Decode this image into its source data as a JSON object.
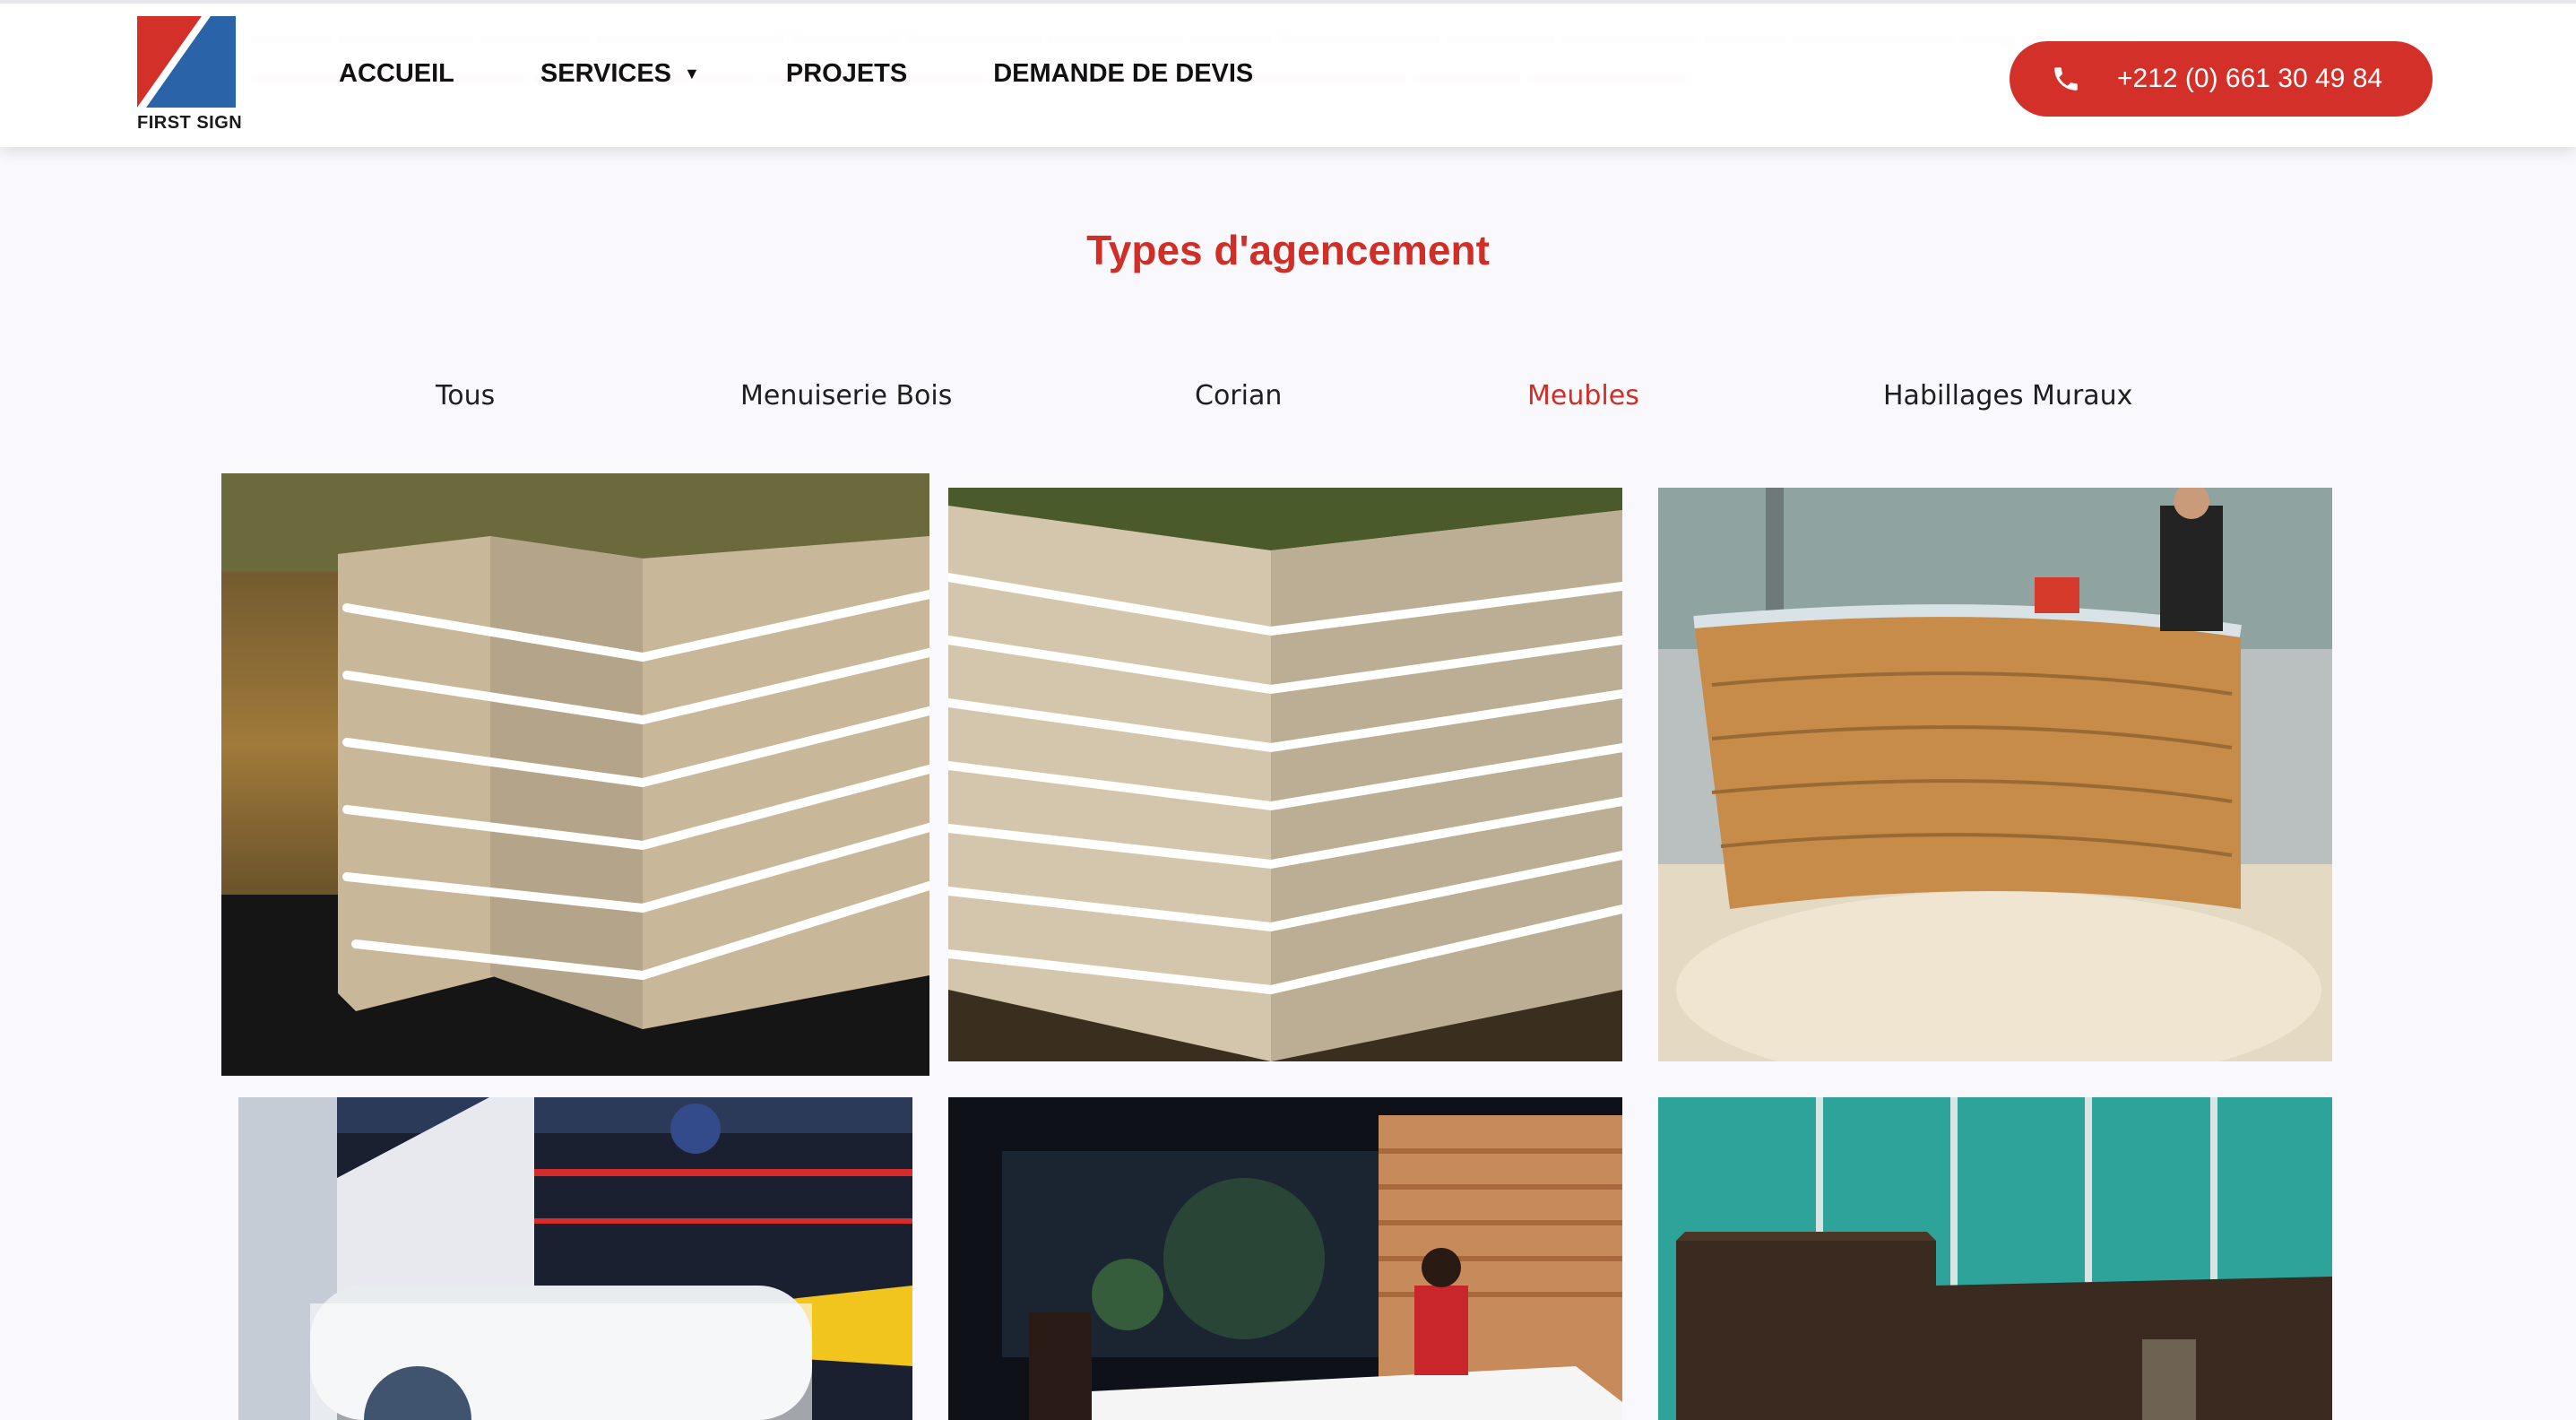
{
  "header": {
    "logo_text": "FIRST SIGN",
    "nav": [
      {
        "label": "ACCUEIL"
      },
      {
        "label": "SERVICES",
        "has_dropdown": true
      },
      {
        "label": "PROJETS"
      },
      {
        "label": "DEMANDE DE DEVIS"
      }
    ],
    "phone_label": "+212 (0) 661 30 49 84"
  },
  "section": {
    "title": "Types d'agencement",
    "filters": [
      "Tous",
      "Menuiserie Bois",
      "Corian",
      "Meubles",
      "Habillages Muraux"
    ],
    "active_filter": "Meubles"
  },
  "gallery": {
    "items": [
      {
        "subject": "led-striped-reception-desk-1"
      },
      {
        "subject": "led-striped-reception-desk-2"
      },
      {
        "subject": "curved-wood-reception-desk"
      },
      {
        "subject": "alfa-romeo-showroom-desk"
      },
      {
        "subject": "tv-studio-desk"
      },
      {
        "subject": "dark-wood-reception-counter"
      }
    ]
  },
  "colors": {
    "accent": "#d4302a",
    "logo_blue": "#2a63a8",
    "logo_red": "#d4302a"
  },
  "icons": {
    "phone": "phone-icon",
    "dropdown": "caret-down-icon"
  }
}
